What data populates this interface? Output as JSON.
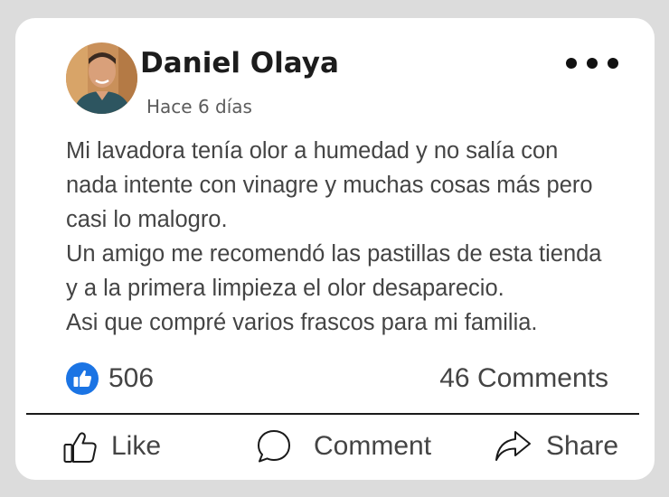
{
  "post": {
    "author_name": "Daniel Olaya",
    "timestamp": "Hace 6 días",
    "body_lines": [
      "Mi lavadora tenía olor a humedad y no salía con",
      "nada intente con vinagre y muchas cosas más pero",
      "casi lo malogro.",
      "Un amigo me recomendó las pastillas de esta tienda",
      "y a la primera limpieza el olor desaparecio.",
      "Asi que compré varios frascos para mi familia."
    ]
  },
  "stats": {
    "likes": "506",
    "comments": "46 Comments"
  },
  "actions": {
    "like_label": "Like",
    "comment_label": "Comment",
    "share_label": "Share"
  },
  "icons": {
    "more": "more-options-icon",
    "like_badge": "thumbs-up-badge-icon",
    "like": "thumbs-up-icon",
    "comment": "speech-bubble-icon",
    "share": "share-arrow-icon"
  },
  "colors": {
    "like_badge": "#1b74e4",
    "text": "#444444",
    "author": "#1c1c1c"
  }
}
